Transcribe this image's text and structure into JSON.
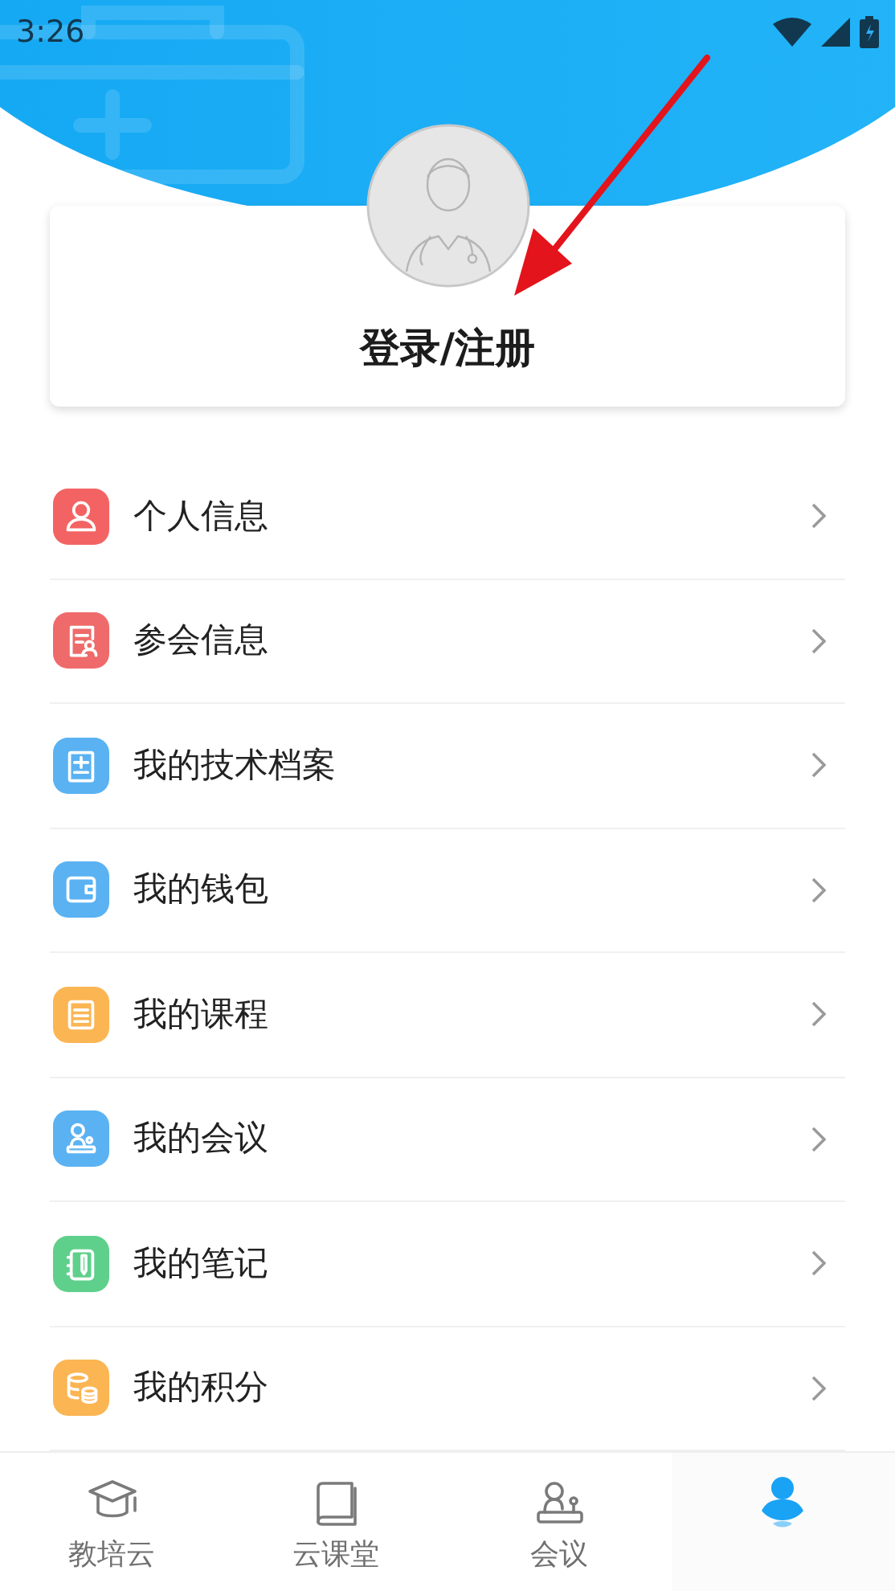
{
  "status_bar": {
    "time": "3:26"
  },
  "profile_card": {
    "login_label": "登录/注册"
  },
  "menu": [
    {
      "label": "个人信息",
      "kind": "person",
      "color": "#f46363"
    },
    {
      "label": "参会信息",
      "kind": "badge",
      "color": "#ef6a6a"
    },
    {
      "label": "我的技术档案",
      "kind": "file",
      "color": "#5ab2f2"
    },
    {
      "label": "我的钱包",
      "kind": "wallet",
      "color": "#5ab2f2"
    },
    {
      "label": "我的课程",
      "kind": "course",
      "color": "#fbb553"
    },
    {
      "label": "我的会议",
      "kind": "meeting",
      "color": "#5ab2f2"
    },
    {
      "label": "我的笔记",
      "kind": "note",
      "color": "#5fd08c"
    },
    {
      "label": "我的积分",
      "kind": "coins",
      "color": "#fbb553"
    }
  ],
  "tab_bar": [
    {
      "label": "教培云",
      "kind": "cap",
      "selected": false
    },
    {
      "label": "云课堂",
      "kind": "book",
      "selected": false
    },
    {
      "label": "会议",
      "kind": "meeting",
      "selected": false
    },
    {
      "kind": "me",
      "selected": true
    }
  ]
}
